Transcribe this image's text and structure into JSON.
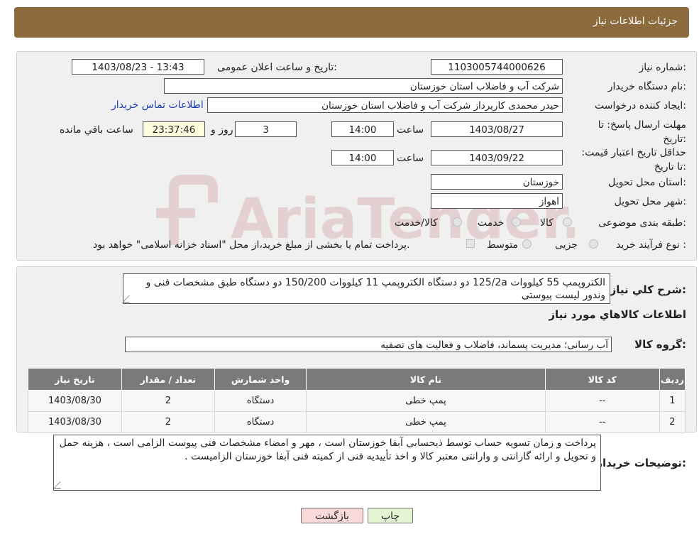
{
  "header": {
    "title": "جزئیات اطلاعات نیاز"
  },
  "details": {
    "need_number_label": "شماره نیاز:",
    "need_number": "1103005744000626",
    "announce_label": "تاریخ و ساعت اعلان عمومی:",
    "announce_value": "1403/08/23 - 13:43",
    "buyer_org_label": "نام دستگاه خریدار:",
    "buyer_org": "شرکت آب و فاضلاب استان خوزستان",
    "creator_label": "ایجاد کننده درخواست:",
    "creator": "حیدر محمدی کارپرداز شرکت آب و فاضلاب استان خوزستان",
    "contact_link": "اطلاعات تماس خریدار",
    "deadline_label": "مهلت ارسال پاسخ: تا تاریخ:",
    "deadline_date": "1403/08/27",
    "time_label": "ساعت",
    "deadline_time": "14:00",
    "days_value": "3",
    "days_label": "روز و",
    "remaining_time": "23:37:46",
    "remaining_label": "ساعت باقي مانده",
    "validity_label": "حداقل تاریخ اعتبار قیمت: تا تاریخ:",
    "validity_date": "1403/09/22",
    "validity_time": "14:00",
    "province_label": "استان محل تحویل:",
    "province": "خوزستان",
    "city_label": "شهر محل تحویل:",
    "city": "اهواز",
    "category_label": "طبقه بندی موضوعی:",
    "category_options": [
      "کالا",
      "خدمت",
      "کالا/خدمت"
    ],
    "process_label": "نوع فرآیند خرید :",
    "process_options": [
      "جزیی",
      "متوسط"
    ],
    "process_note": "پرداخت تمام یا بخشی از مبلغ خرید،از محل \"اسناد خزانه اسلامی\" خواهد بود."
  },
  "summary": {
    "desc_label": "شرح کلي نياز:",
    "desc_text": "الکتروپمپ 55 کیلووات 125/2a دو دستگاه الکتروپمپ 11 کیلووات 150/200 دو دستگاه طبق مشخصات فنی و وندور لیست پیوستی",
    "goods_info_title": "اطلاعات کالاهاي مورد نياز",
    "group_label": "گروه کالا:",
    "group_value": "آب رسانی؛ مدیریت پسماند، فاضلاب و فعالیت های تصفیه"
  },
  "table": {
    "headers": [
      "ردیف",
      "کد کالا",
      "نام کالا",
      "واحد شمارش",
      "تعداد / مقدار",
      "تاریخ نیاز"
    ],
    "rows": [
      [
        "1",
        "--",
        "پمپ خطی",
        "دستگاه",
        "2",
        "1403/08/30"
      ],
      [
        "2",
        "--",
        "پمپ خطی",
        "دستگاه",
        "2",
        "1403/08/30"
      ]
    ]
  },
  "notes": {
    "label": "توضیحات خریدار:",
    "text": "پرداخت و زمان تسویه حساب توسط ذیحسابی آبفا خوزستان است ، مهر و امضاء مشخصات فنی پیوست الزامی است ، هزینه حمل و تحویل و ارائه گارانتی و وارانتی معتبر کالا و اخذ تأییدیه فنی از کمیته فنی آبفا خوزستان الزامیست ."
  },
  "buttons": {
    "print": "چاپ",
    "back": "بازگشت"
  },
  "watermark": {
    "text": "AriaTender.neT"
  },
  "colors": {
    "header": "#8b6a3e",
    "table_header": "#7a7a7a",
    "back_button": "#f9d9d9",
    "print_button": "#e4f5d4",
    "link": "#1a3fb0"
  }
}
